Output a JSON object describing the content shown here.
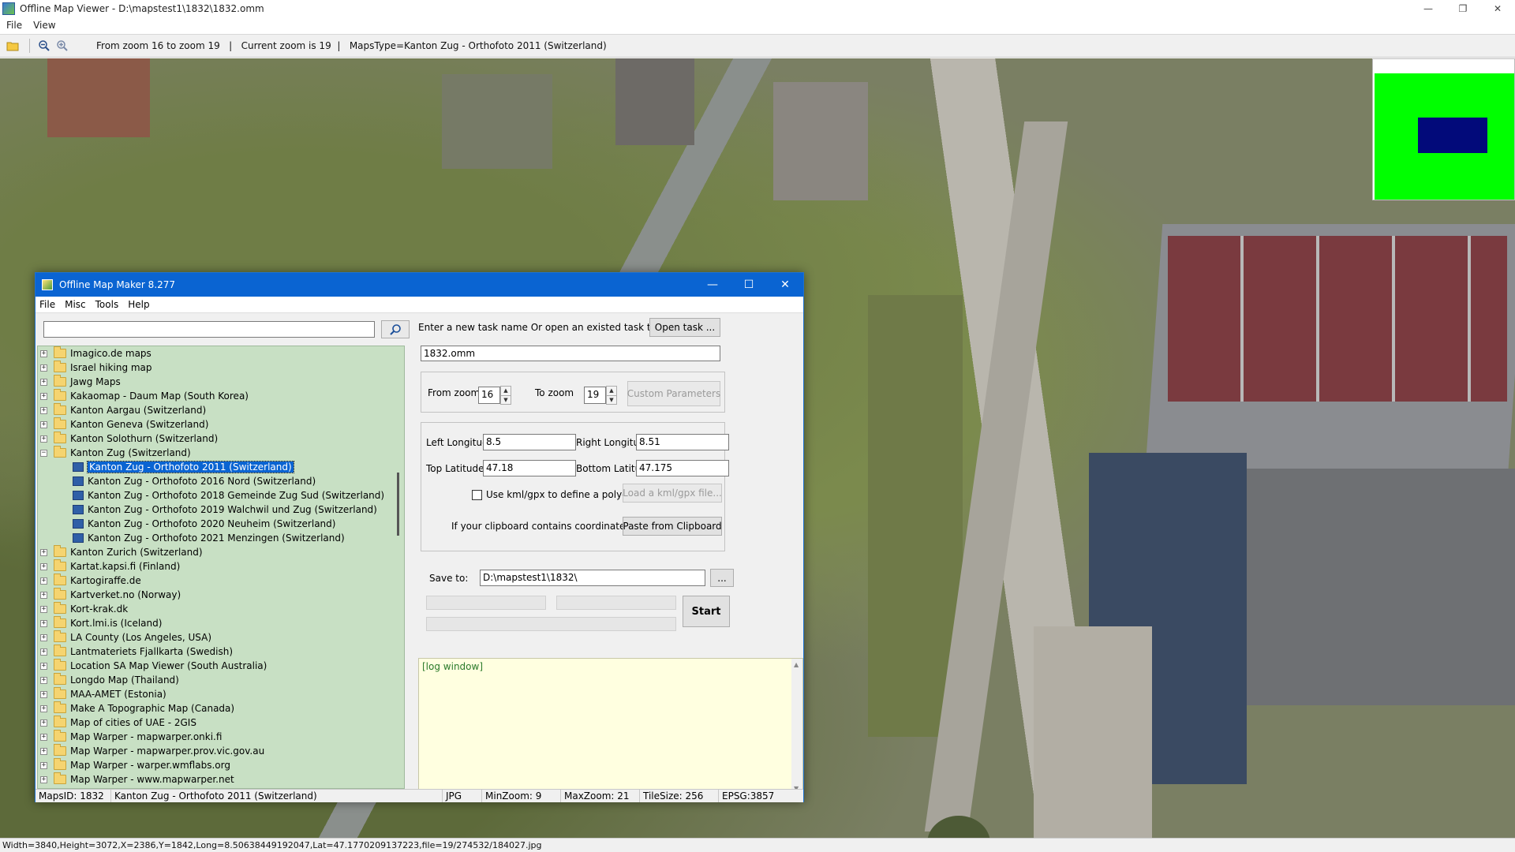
{
  "main": {
    "title": "Offline Map Viewer - D:\\mapstest1\\1832\\1832.omm",
    "menu": [
      "File",
      "View"
    ],
    "toolbar_info": "From zoom 16 to zoom 19   |   Current zoom is 19  |   MapsType=Kanton Zug - Orthofoto 2011 (Switzerland)",
    "window_controls": [
      "—",
      "❐",
      "✕"
    ],
    "status": "Width=3840,Height=3072,X=2386,Y=1842,Long=8.50638449192047,Lat=47.1770209137223,file=19/274532/184027.jpg"
  },
  "dialog": {
    "title": "Offline Map Maker 8.277",
    "menu": [
      "File",
      "Misc",
      "Tools",
      "Help"
    ],
    "search": {
      "value": "",
      "placeholder": ""
    },
    "tree": [
      {
        "label": "Imagico.de maps",
        "expanded": false
      },
      {
        "label": "Israel hiking map",
        "expanded": false
      },
      {
        "label": "Jawg Maps",
        "expanded": false
      },
      {
        "label": "Kakaomap - Daum Map (South Korea)",
        "expanded": false
      },
      {
        "label": "Kanton Aargau (Switzerland)",
        "expanded": false
      },
      {
        "label": "Kanton Geneva (Switzerland)",
        "expanded": false
      },
      {
        "label": "Kanton Solothurn (Switzerland)",
        "expanded": false
      },
      {
        "label": "Kanton Zug (Switzerland)",
        "expanded": true
      },
      {
        "label": "Kanton Zug - Orthofoto 2011 (Switzerland)",
        "child": true,
        "selected": true
      },
      {
        "label": "Kanton Zug - Orthofoto 2016 Nord (Switzerland)",
        "child": true
      },
      {
        "label": "Kanton Zug - Orthofoto 2018 Gemeinde Zug Sud (Switzerland)",
        "child": true
      },
      {
        "label": "Kanton Zug - Orthofoto 2019 Walchwil und Zug (Switzerland)",
        "child": true
      },
      {
        "label": "Kanton Zug - Orthofoto 2020 Neuheim (Switzerland)",
        "child": true
      },
      {
        "label": "Kanton Zug - Orthofoto 2021 Menzingen (Switzerland)",
        "child": true
      },
      {
        "label": "Kanton Zurich (Switzerland)",
        "expanded": false
      },
      {
        "label": "Kartat.kapsi.fi (Finland)",
        "expanded": false
      },
      {
        "label": "Kartogiraffe.de",
        "expanded": false
      },
      {
        "label": "Kartverket.no (Norway)",
        "expanded": false
      },
      {
        "label": "Kort-krak.dk",
        "expanded": false
      },
      {
        "label": "Kort.lmi.is (Iceland)",
        "expanded": false
      },
      {
        "label": "LA County (Los Angeles, USA)",
        "expanded": false
      },
      {
        "label": "Lantmateriets Fjallkarta (Swedish)",
        "expanded": false
      },
      {
        "label": "Location SA Map Viewer (South Australia)",
        "expanded": false
      },
      {
        "label": "Longdo Map (Thailand)",
        "expanded": false
      },
      {
        "label": "MAA-AMET (Estonia)",
        "expanded": false
      },
      {
        "label": "Make A Topographic Map (Canada)",
        "expanded": false
      },
      {
        "label": "Map of cities of UAE - 2GIS",
        "expanded": false
      },
      {
        "label": "Map Warper - mapwarper.onki.fi",
        "expanded": false
      },
      {
        "label": "Map Warper - mapwarper.prov.vic.gov.au",
        "expanded": false
      },
      {
        "label": "Map Warper - warper.wmflabs.org",
        "expanded": false
      },
      {
        "label": "Map Warper - www.mapwarper.net",
        "expanded": false
      }
    ],
    "task": {
      "prompt": "Enter a new task name Or open an existed task to continue:",
      "open_button": "Open task ...",
      "name": "1832.omm"
    },
    "zoom": {
      "from_label": "From zoom",
      "from_value": "16",
      "to_label": "To zoom",
      "to_value": "19",
      "custom_button": "Custom Parameters"
    },
    "area": {
      "left_lon_label": "Left Longitude",
      "left_lon": "8.5",
      "right_lon_label": "Right Longitude",
      "right_lon": "8.51",
      "top_lat_label": "Top Latitude",
      "top_lat": "47.18",
      "bottom_lat_label": "Bottom Latitude",
      "bottom_lat": "47.175",
      "kml_checkbox": "Use kml/gpx to define a polygon area",
      "kml_button": "Load a kml/gpx file...",
      "clipboard_label": "If your clipboard contains coordinates values:",
      "clipboard_button": "Paste from Clipboard"
    },
    "save": {
      "label": "Save to:",
      "path": "D:\\mapstest1\\1832\\",
      "browse": "..."
    },
    "start_button": "Start",
    "log_label": "[log window]",
    "status": {
      "maps_id": "MapsID: 1832",
      "name": "Kanton Zug - Orthofoto 2011 (Switzerland)",
      "format": "JPG",
      "min_zoom": "MinZoom: 9",
      "max_zoom": "MaxZoom: 21",
      "tile_size": "TileSize: 256",
      "epsg": "EPSG:3857"
    }
  },
  "colors": {
    "accent": "#0a64d2",
    "tree_bg": "#c8e0c4",
    "log_bg": "#ffffe0",
    "minimap_green": "#00ff00",
    "minimap_view": "#020a7a"
  }
}
